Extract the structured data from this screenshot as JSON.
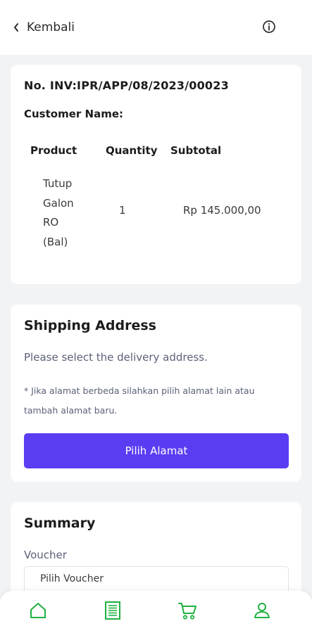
{
  "header": {
    "back_label": "Kembali",
    "back_icon": "chevron-left-icon",
    "info_icon": "info-circle-icon"
  },
  "invoice": {
    "number": "No. INV:IPR/APP/08/2023/00023",
    "customer_label": "Customer Name:",
    "columns": [
      "Product",
      "Quantity",
      "Subtotal"
    ],
    "rows": [
      {
        "product_lines": [
          "Tutup",
          "Galon",
          "RO",
          "(Bal)"
        ],
        "quantity": "1",
        "subtotal": "Rp 145.000,00"
      }
    ]
  },
  "shipping": {
    "title": "Shipping Address",
    "subtitle": "Please select the delivery address.",
    "note": "* Jika alamat berbeda silahkan pilih alamat lain atau tambah alamat baru.",
    "button_label": "Pilih Alamat"
  },
  "summary": {
    "title": "Summary",
    "voucher_label": "Voucher",
    "voucher_placeholder": "Pilih Voucher"
  },
  "bottom_nav": {
    "items": [
      "home-icon",
      "orders-icon",
      "cart-icon",
      "profile-icon"
    ]
  },
  "colors": {
    "accent": "#5a3df2",
    "nav_icon": "#1fb141",
    "background": "#f2f3f5"
  }
}
